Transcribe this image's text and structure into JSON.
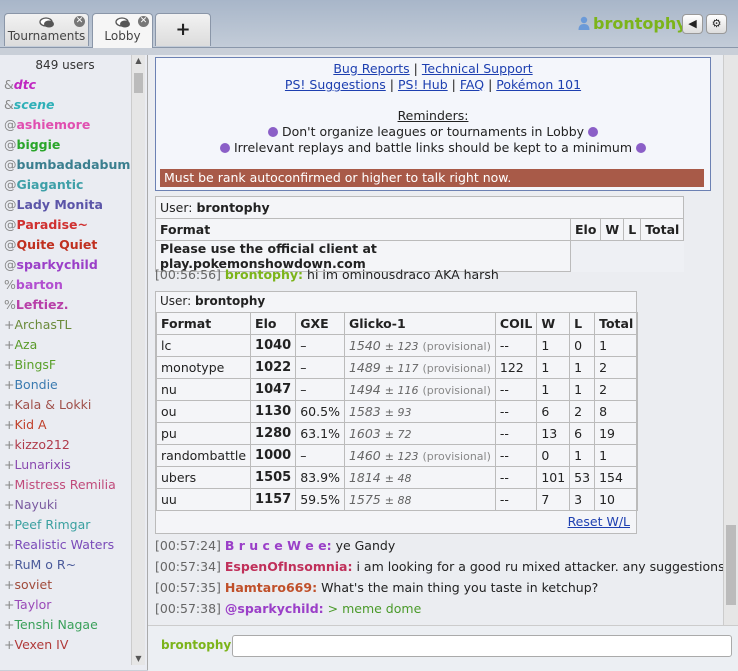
{
  "header": {
    "tabs": [
      {
        "label": "Tournaments",
        "icon": "chat-bubbles-icon",
        "active": false
      },
      {
        "label": "Lobby",
        "icon": "chat-bubbles-icon",
        "active": true
      }
    ],
    "add_tab": "+",
    "username": "brontophy",
    "sound_icon": "◀",
    "settings_icon": "⚙"
  },
  "userlist": {
    "count": "849 users",
    "users": [
      {
        "rank": "&",
        "name": "dtc",
        "color": "#c026c0",
        "italic": true
      },
      {
        "rank": "&",
        "name": "scene",
        "color": "#2fb0b8",
        "italic": true
      },
      {
        "rank": "@",
        "name": "ashiemore",
        "color": "#e04fb0"
      },
      {
        "rank": "@",
        "name": "biggie",
        "color": "#2aa52a"
      },
      {
        "rank": "@",
        "name": "bumbadadabum",
        "color": "#3b7f8f"
      },
      {
        "rank": "@",
        "name": "Giagantic",
        "color": "#3ea0a8"
      },
      {
        "rank": "@",
        "name": "Lady Monita",
        "color": "#5b55a8"
      },
      {
        "rank": "@",
        "name": "Paradise~",
        "color": "#d03030"
      },
      {
        "rank": "@",
        "name": "Quite Quiet",
        "color": "#c0301f"
      },
      {
        "rank": "@",
        "name": "sparkychild",
        "color": "#9b3fc8"
      },
      {
        "rank": "%",
        "name": "barton",
        "color": "#b24fd0"
      },
      {
        "rank": "%",
        "name": "Leftiez.",
        "color": "#b83fa8"
      },
      {
        "rank": "+",
        "name": "ArchasTL",
        "color": "#6a8a3a"
      },
      {
        "rank": "+",
        "name": "Aza",
        "color": "#5a9a2a"
      },
      {
        "rank": "+",
        "name": "BingsF",
        "color": "#5aa02a"
      },
      {
        "rank": "+",
        "name": "Bondie",
        "color": "#3a7ab0"
      },
      {
        "rank": "+",
        "name": "Kala & Lokki",
        "color": "#a0504a"
      },
      {
        "rank": "+",
        "name": "Kid A",
        "color": "#c0402a"
      },
      {
        "rank": "+",
        "name": "kizzo212",
        "color": "#b03a4a"
      },
      {
        "rank": "+",
        "name": "Lunarixis",
        "color": "#8a4ab0"
      },
      {
        "rank": "+",
        "name": "Mistress Remilia",
        "color": "#c04a7a"
      },
      {
        "rank": "+",
        "name": "Nayuki",
        "color": "#7a5aa0"
      },
      {
        "rank": "+",
        "name": "Peef Rimgar",
        "color": "#3aa0a0"
      },
      {
        "rank": "+",
        "name": "Realistic Waters",
        "color": "#7a4ab8"
      },
      {
        "rank": "+",
        "name": "RuM o R~",
        "color": "#4a5a9a"
      },
      {
        "rank": "+",
        "name": "soviet",
        "color": "#a04a3a"
      },
      {
        "rank": "+",
        "name": "Taylor",
        "color": "#9a4ab8"
      },
      {
        "rank": "+",
        "name": "Tenshi Nagae",
        "color": "#3aa05a"
      },
      {
        "rank": "+",
        "name": "Vexen IV",
        "color": "#b03a3a"
      }
    ]
  },
  "infobox": {
    "links_row1": [
      "Bug Reports",
      "|",
      "Technical Support"
    ],
    "links_row2": [
      "PS! Suggestions",
      "|",
      "PS! Hub",
      "|",
      "FAQ",
      "|",
      "Pokémon 101"
    ],
    "reminders_title": "Reminders:",
    "reminder1": "Don't organize leagues or tournaments in Lobby",
    "reminder2": "Irrelevant replays and battle links should be kept to a minimum",
    "error": "Must be rank autoconfirmed or higher to talk right now."
  },
  "ladder_notice": {
    "user_label": "User:",
    "user": "brontophy",
    "headers": [
      "Format",
      "Elo",
      "W",
      "L",
      "Total"
    ],
    "message": "Please use the official client at play.pokemonshowdown.com"
  },
  "msg1": {
    "ts": "[00:56:56]",
    "name": "brontophy:",
    "text": "hi im ominousdraco AKA harsh",
    "color": "#7cb41a"
  },
  "stats": {
    "user_label": "User:",
    "user": "brontophy",
    "headers": [
      "Format",
      "Elo",
      "GXE",
      "Glicko-1",
      "COIL",
      "W",
      "L",
      "Total"
    ],
    "rows": [
      {
        "format": "lc",
        "elo": "1040",
        "gxe": "–",
        "glicko": "1540",
        "dev": "± 123",
        "prov": "(provisional)",
        "coil": "--",
        "w": "1",
        "l": "0",
        "total": "1"
      },
      {
        "format": "monotype",
        "elo": "1022",
        "gxe": "–",
        "glicko": "1489",
        "dev": "± 117",
        "prov": "(provisional)",
        "coil": "122",
        "w": "1",
        "l": "1",
        "total": "2"
      },
      {
        "format": "nu",
        "elo": "1047",
        "gxe": "–",
        "glicko": "1494",
        "dev": "± 116",
        "prov": "(provisional)",
        "coil": "--",
        "w": "1",
        "l": "1",
        "total": "2"
      },
      {
        "format": "ou",
        "elo": "1130",
        "gxe": "60.5%",
        "glicko": "1583",
        "dev": "± 93",
        "prov": "",
        "coil": "--",
        "w": "6",
        "l": "2",
        "total": "8"
      },
      {
        "format": "pu",
        "elo": "1280",
        "gxe": "63.1%",
        "glicko": "1603",
        "dev": "± 72",
        "prov": "",
        "coil": "--",
        "w": "13",
        "l": "6",
        "total": "19"
      },
      {
        "format": "randombattle",
        "elo": "1000",
        "gxe": "–",
        "glicko": "1460",
        "dev": "± 123",
        "prov": "(provisional)",
        "coil": "--",
        "w": "0",
        "l": "1",
        "total": "1"
      },
      {
        "format": "ubers",
        "elo": "1505",
        "gxe": "83.9%",
        "glicko": "1814",
        "dev": "± 48",
        "prov": "",
        "coil": "--",
        "w": "101",
        "l": "53",
        "total": "154"
      },
      {
        "format": "uu",
        "elo": "1157",
        "gxe": "59.5%",
        "glicko": "1575",
        "dev": "± 88",
        "prov": "",
        "coil": "--",
        "w": "7",
        "l": "3",
        "total": "10"
      }
    ],
    "reset": "Reset W/L"
  },
  "messages": [
    {
      "ts": "[00:57:24]",
      "name": "B r u c e W e e:",
      "text": "ye Gandy",
      "color": "#9a3fc8"
    },
    {
      "ts": "[00:57:34]",
      "name": "EspenOfInsomnia:",
      "text": "i am looking for a good ru mixed attacker. any suggestions?",
      "color": "#c0305a"
    },
    {
      "ts": "[00:57:35]",
      "name": "Hamtaro669:",
      "text": "What's the main thing you taste in ketchup?",
      "color": "#c0502a"
    },
    {
      "ts": "[00:57:38]",
      "name": "@sparkychild:",
      "text": "> meme dome",
      "color": "#9b3fc8",
      "text_color": "#4a9a2a"
    }
  ],
  "compose": {
    "name": "brontophy:",
    "value": ""
  }
}
